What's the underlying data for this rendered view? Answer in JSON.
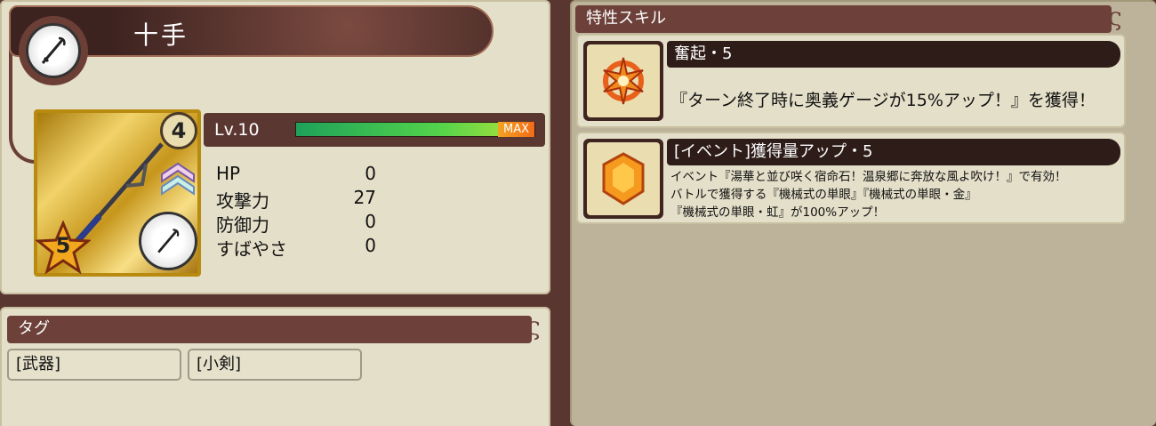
{
  "item": {
    "name": "十手",
    "rarity": "4",
    "stars": "5",
    "level": "Lv.10",
    "level_state": "MAX",
    "level_progress": 1.0,
    "stats": [
      {
        "label": "HP",
        "value": "0"
      },
      {
        "label": "攻撃力",
        "value": "27"
      },
      {
        "label": "防御力",
        "value": "0"
      },
      {
        "label": "すばやさ",
        "value": "0"
      }
    ]
  },
  "tags": {
    "header": "タグ",
    "items": [
      "[武器]",
      "[小剣]"
    ]
  },
  "skills": {
    "header": "特性スキル",
    "items": [
      {
        "name": "奮起・5",
        "icon": "burst-sun-icon",
        "description_lines": [
          "『ターン終了時に奥義ゲージが15%アップ！』を獲得！"
        ]
      },
      {
        "name": "[イベント]獲得量アップ・5",
        "icon": "orange-gem-icon",
        "description_lines": [
          "イベント『湯華と並び咲く宿命石！温泉郷に奔放な風よ吹け！』で有効！",
          "バトルで獲得する『機械式の単眼』『機械式の単眼・金』",
          "『機械式の単眼・虹』が100%アップ！"
        ]
      }
    ]
  },
  "colors": {
    "panel": "#e4dfc9",
    "header": "#6d413a",
    "frame": "#5a3631",
    "gold": "#d8ae2b"
  }
}
